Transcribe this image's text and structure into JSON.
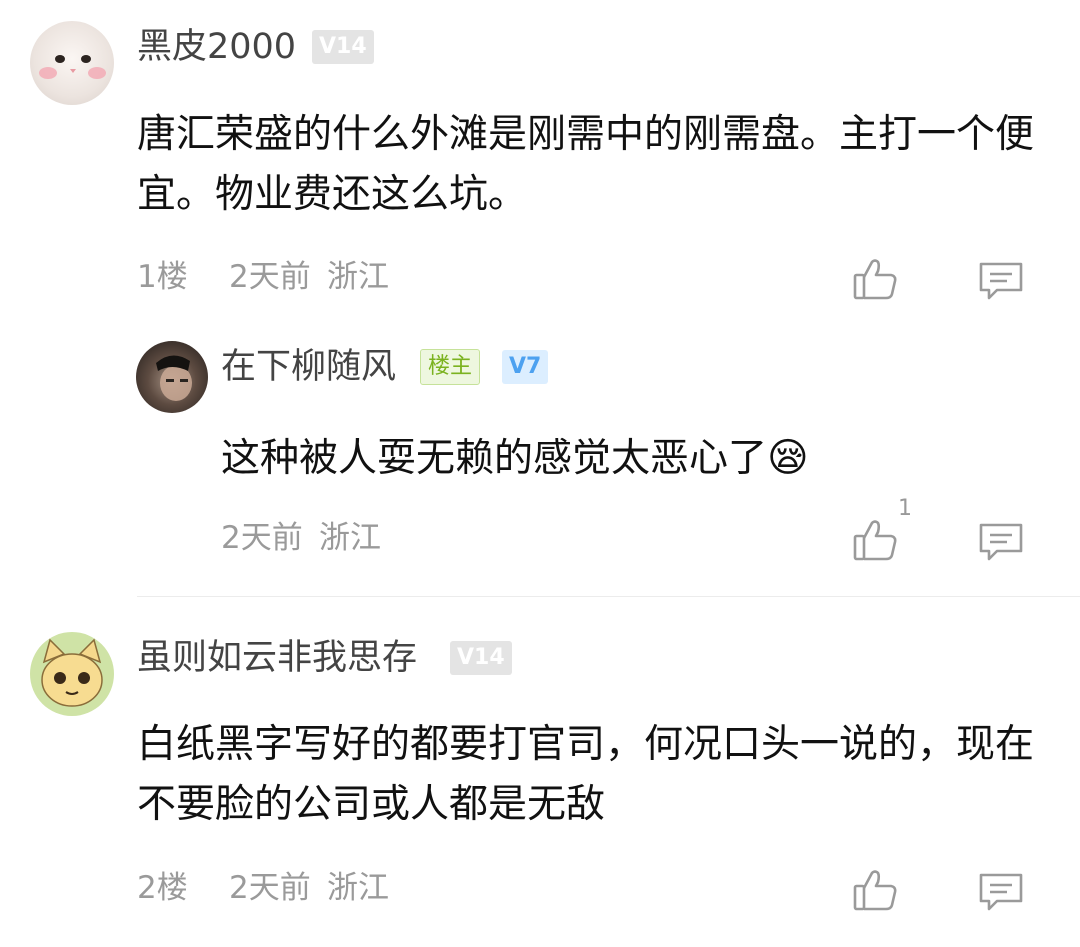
{
  "comments": [
    {
      "username": "黑皮2000",
      "level": "V14",
      "content": "唐汇荣盛的什么外滩是刚需中的刚需盘。主打一个便宜。物业费还这么坑。",
      "floor": "1楼",
      "time": "2天前",
      "location": "浙江",
      "reply": {
        "username": "在下柳随风",
        "owner_badge": "楼主",
        "level": "V7",
        "content": "这种被人耍无赖的感觉太恶心了",
        "emoji": "😪",
        "time": "2天前",
        "location": "浙江",
        "like_count": "1"
      }
    },
    {
      "username": "虽则如云非我思存",
      "level": "V14",
      "content": "白纸黑字写好的都要打官司，何况口头一说的，现在不要脸的公司或人都是无敌",
      "floor": "2楼",
      "time": "2天前",
      "location": "浙江"
    }
  ],
  "icons": {
    "like": "thumbs-up-icon",
    "reply": "comment-icon"
  },
  "colors": {
    "meta_text": "#9a9a9a",
    "level_blue": "#4da1f0",
    "owner_green": "#7bb21f"
  }
}
